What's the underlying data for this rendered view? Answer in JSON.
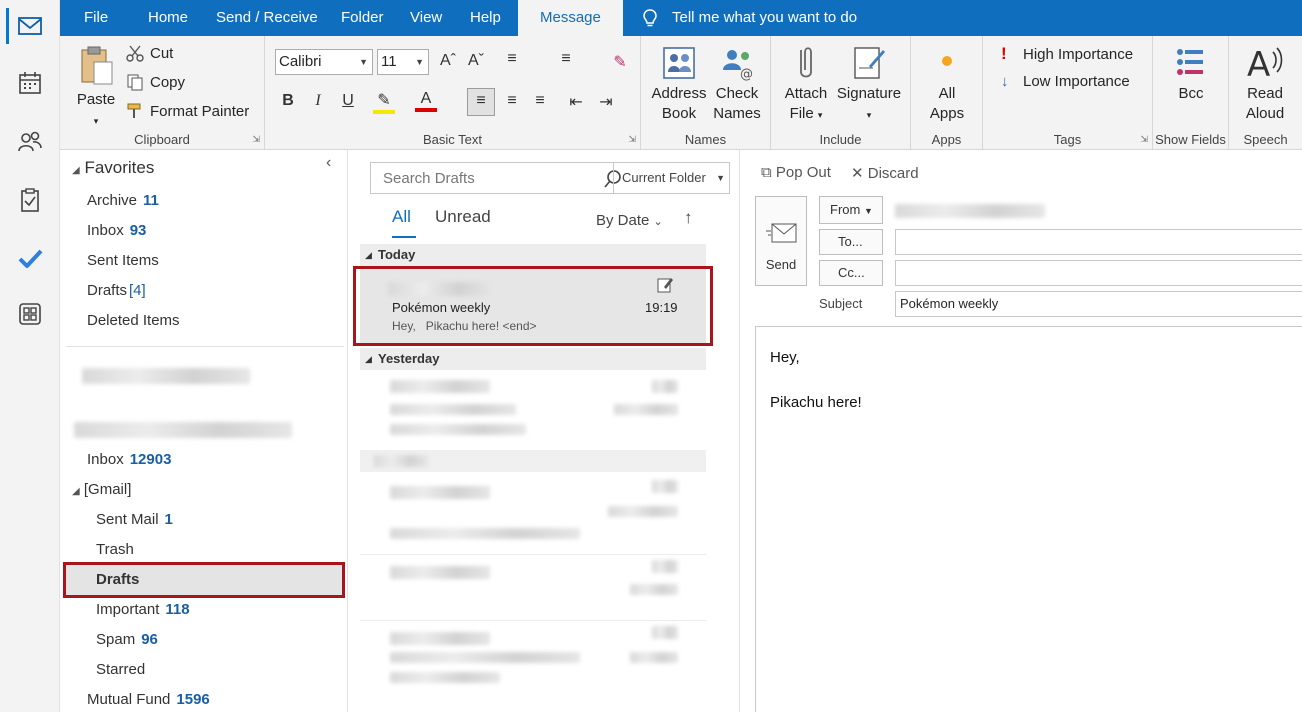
{
  "menu": {
    "tabs": [
      "File",
      "Home",
      "Send / Receive",
      "Folder",
      "View",
      "Help",
      "Message"
    ],
    "tell_me": "Tell me what you want to do"
  },
  "ribbon": {
    "clipboard": {
      "paste": "Paste",
      "cut": "Cut",
      "copy": "Copy",
      "format_painter": "Format Painter",
      "label": "Clipboard"
    },
    "basic_text": {
      "font": "Calibri",
      "size": "11",
      "label": "Basic Text"
    },
    "names": {
      "address_book_1": "Address",
      "address_book_2": "Book",
      "check_names_1": "Check",
      "check_names_2": "Names",
      "label": "Names"
    },
    "include": {
      "attach_1": "Attach",
      "attach_2": "File",
      "signature": "Signature",
      "label": "Include"
    },
    "apps": {
      "all_apps_1": "All",
      "all_apps_2": "Apps",
      "label": "Apps"
    },
    "tags": {
      "high": "High Importance",
      "low": "Low Importance",
      "label": "Tags"
    },
    "show_fields": {
      "bcc": "Bcc",
      "label": "Show Fields"
    },
    "speech": {
      "read_1": "Read",
      "read_2": "Aloud",
      "label": "Speech"
    }
  },
  "folders": {
    "favorites_title": "Favorites",
    "favorites": [
      {
        "name": "Archive",
        "count": "11"
      },
      {
        "name": "Inbox",
        "count": "93"
      },
      {
        "name": "Sent Items",
        "count": ""
      },
      {
        "name": "Drafts",
        "count": "[4]"
      },
      {
        "name": "Deleted Items",
        "count": ""
      }
    ],
    "account_inbox": {
      "name": "Inbox",
      "count": "12903"
    },
    "gmail_title": "[Gmail]",
    "gmail": [
      {
        "name": "Sent Mail",
        "count": "1"
      },
      {
        "name": "Trash",
        "count": ""
      },
      {
        "name": "Drafts",
        "count": ""
      },
      {
        "name": "Important",
        "count": "118"
      },
      {
        "name": "Spam",
        "count": "96"
      },
      {
        "name": "Starred",
        "count": ""
      }
    ],
    "mutual_fund": {
      "name": "Mutual Fund",
      "count": "1596"
    }
  },
  "list": {
    "search_placeholder": "Search Drafts",
    "scope": "Current Folder",
    "tab_all": "All",
    "tab_unread": "Unread",
    "sort": "By Date",
    "today": "Today",
    "yesterday": "Yesterday",
    "selected": {
      "subject": "Pokémon weekly",
      "time": "19:19",
      "preview": "Hey,   Pikachu here! <end>"
    }
  },
  "compose": {
    "pop_out": "Pop Out",
    "discard": "Discard",
    "send": "Send",
    "from": "From",
    "to": "To...",
    "cc": "Cc...",
    "subject_label": "Subject",
    "subject_value": "Pokémon weekly",
    "body_line1": "Hey,",
    "body_line2": "Pikachu here!"
  },
  "colors": {
    "accent": "#106ebe",
    "highlight": "#a8151c",
    "count": "#1b5ea5"
  }
}
